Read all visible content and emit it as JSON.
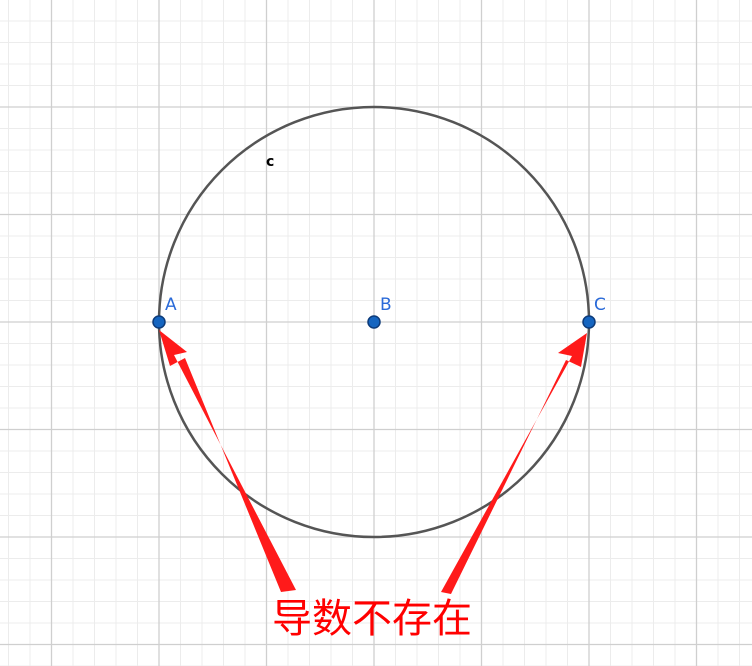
{
  "points": [
    {
      "id": "A",
      "label": "A"
    },
    {
      "id": "B",
      "label": "B"
    },
    {
      "id": "C",
      "label": "C"
    }
  ],
  "circle": {
    "label": "c"
  },
  "annotation": {
    "text": "导数不存在"
  },
  "colors": {
    "point_fill": "#1565c0",
    "point_label": "#2a6ad8",
    "circle_stroke": "#555555",
    "arrow": "#ff1a1a",
    "annotation_text": "#ff0000",
    "grid_major": "#cfcfcf",
    "grid_minor": "#ececec"
  }
}
